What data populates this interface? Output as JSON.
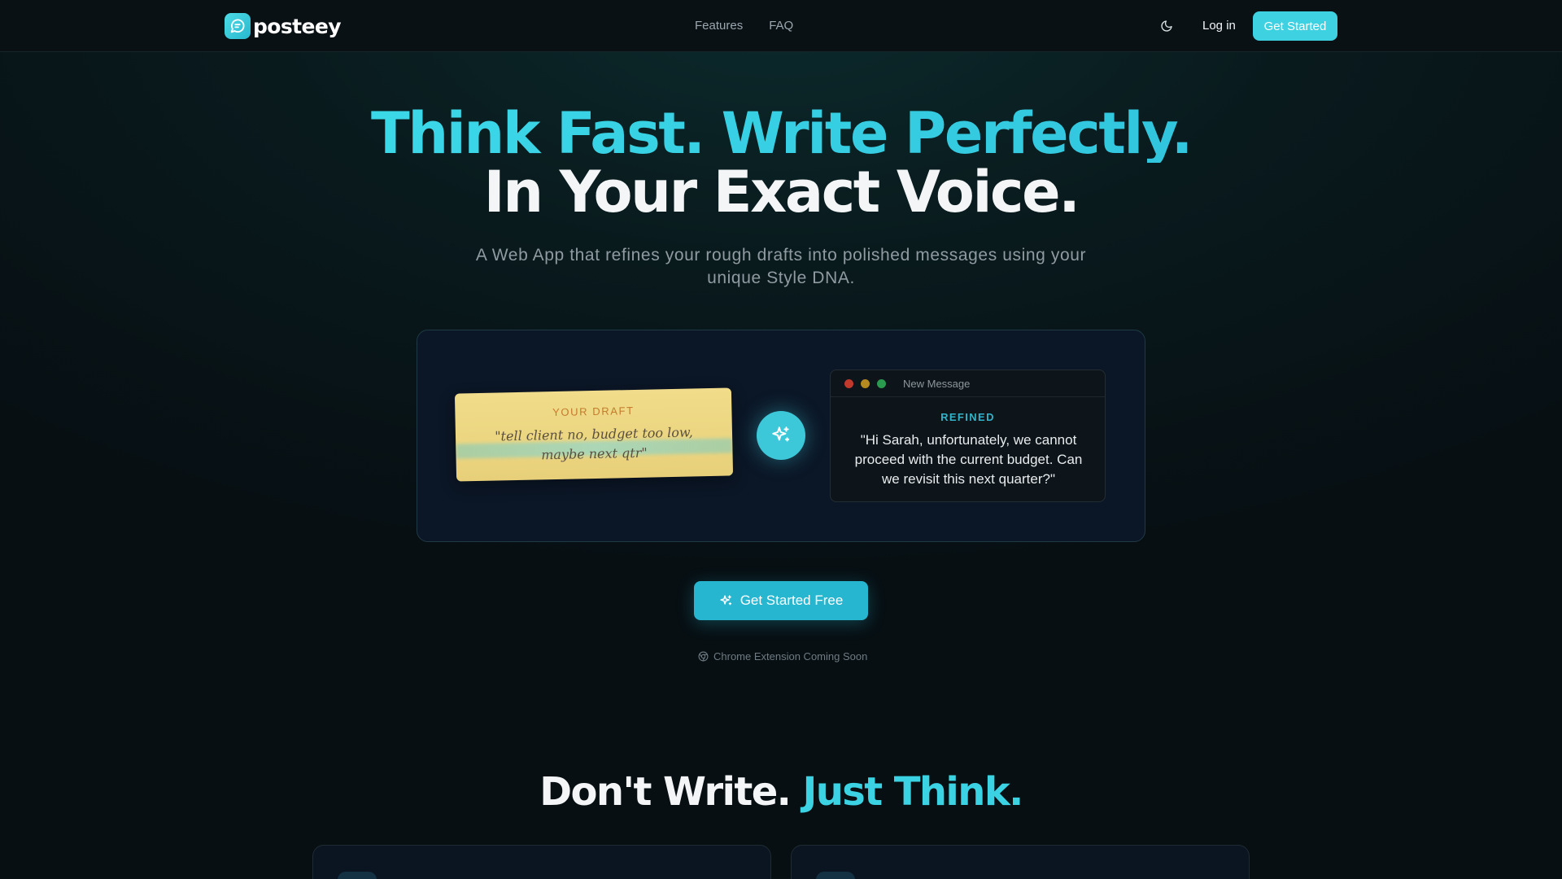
{
  "brand": {
    "name": "posteey"
  },
  "nav": {
    "links": [
      "Features",
      "FAQ"
    ],
    "login": "Log in",
    "cta": "Get Started",
    "theme_icon": "moon-icon"
  },
  "hero": {
    "title_line1": "Think Fast. Write Perfectly.",
    "title_line2": "In Your Exact Voice.",
    "subtitle": "A Web App that refines your rough drafts into polished messages using your unique Style DNA."
  },
  "demo": {
    "draft_label": "YOUR DRAFT",
    "draft_text": "\"tell client no, budget too low, maybe next qtr\"",
    "window_title": "New Message",
    "refined_label": "REFINED",
    "refined_text": "\"Hi Sarah, unfortunately, we cannot proceed with the current budget. Can we revisit this next quarter?\"",
    "window_dots": [
      "#d9443b",
      "#e0a82e",
      "#2fb35a"
    ]
  },
  "cta": {
    "label": "Get Started Free",
    "note": "Chrome Extension Coming Soon"
  },
  "section": {
    "title_part1": "Don't Write.",
    "title_part2": "Just Think."
  },
  "colors": {
    "accent": "#3bd3e3",
    "button": "#27b6cf",
    "draft": "#f0dc8a"
  }
}
